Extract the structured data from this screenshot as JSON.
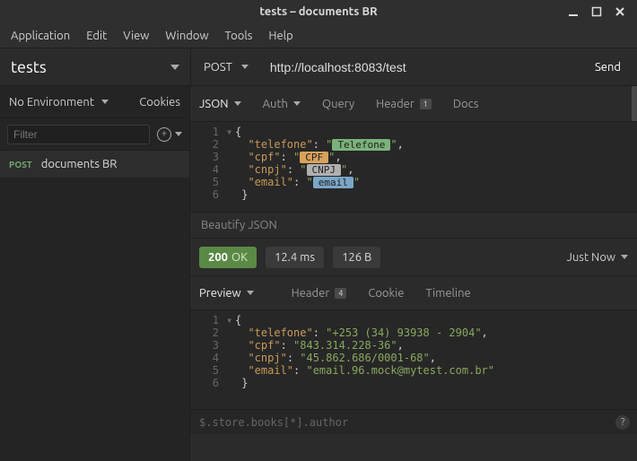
{
  "window": {
    "title": "tests – documents BR"
  },
  "menus": [
    "Application",
    "Edit",
    "View",
    "Window",
    "Tools",
    "Help"
  ],
  "topbar": {
    "tab_name": "tests",
    "method": "POST",
    "url": "http://localhost:8083/test",
    "send": "Send"
  },
  "sidebar": {
    "env": "No Environment",
    "cookies": "Cookies",
    "filter_placeholder": "Filter",
    "items": [
      {
        "method": "POST",
        "name": "documents BR"
      }
    ]
  },
  "req_tabs": {
    "json": "JSON",
    "auth": "Auth",
    "query": "Query",
    "header": "Header",
    "header_badge": "1",
    "docs": "Docs"
  },
  "request_body": {
    "lines": [
      {
        "n": "1",
        "fold": "▾",
        "raw": "{"
      },
      {
        "n": "2",
        "key": "telefone",
        "chip": "Telefone",
        "chip_cls": "chip-telefone",
        "trail": ","
      },
      {
        "n": "3",
        "key": "cpf",
        "chip": "CPF",
        "chip_cls": "chip-cpf",
        "trail": ","
      },
      {
        "n": "4",
        "key": "cnpj",
        "chip": "CNPJ",
        "chip_cls": "chip-cnpj",
        "trail": ","
      },
      {
        "n": "5",
        "key": "email",
        "chip": "email",
        "chip_cls": "chip-email",
        "trail": ""
      },
      {
        "n": "6",
        "raw": " }"
      }
    ]
  },
  "beautify": "Beautify JSON",
  "status": {
    "code": "200",
    "text": "OK",
    "time": "12.4 ms",
    "size": "126 B",
    "when": "Just Now"
  },
  "resp_tabs": {
    "preview": "Preview",
    "header": "Header",
    "header_badge": "4",
    "cookie": "Cookie",
    "timeline": "Timeline"
  },
  "response_body": {
    "lines": [
      {
        "n": "1",
        "fold": "▾",
        "raw": "{"
      },
      {
        "n": "2",
        "key": "telefone",
        "val": "+253 (34) 93938 - 2904",
        "trail": ","
      },
      {
        "n": "3",
        "key": "cpf",
        "val": "843.314.228-36",
        "trail": ","
      },
      {
        "n": "4",
        "key": "cnpj",
        "val": "45.862.686/0001-68",
        "trail": ","
      },
      {
        "n": "5",
        "key": "email",
        "val": "email.96.mock@mytest.com.br",
        "trail": ""
      },
      {
        "n": "6",
        "raw": " }"
      }
    ]
  },
  "jsonpath_placeholder": "$.store.books[*].author"
}
